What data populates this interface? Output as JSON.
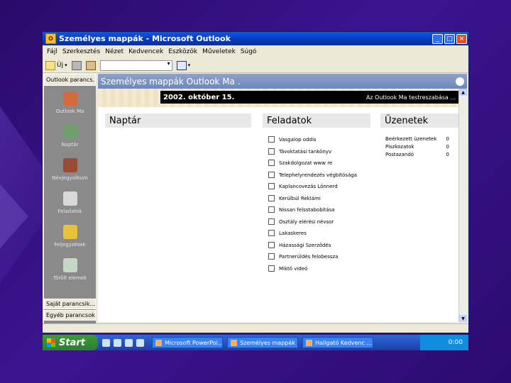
{
  "window": {
    "title": "Személyes mappák - Microsoft Outlook",
    "min": "_",
    "max": "□",
    "close": "×",
    "app_icon": "O"
  },
  "menu": [
    "Fájl",
    "Szerkesztés",
    "Nézet",
    "Kedvencek",
    "Eszközök",
    "Műveletek",
    "Súgó"
  ],
  "toolbar": {
    "new_label": "Új",
    "address_value": ""
  },
  "left_panel": {
    "header": "Outlook parancs...",
    "items": [
      {
        "label": "Outlook Ma",
        "icon": "outlook-today-icon",
        "color": "#d36b3c"
      },
      {
        "label": "Naptár",
        "icon": "calendar-icon",
        "color": "#6da06d"
      },
      {
        "label": "Névjegyalbum",
        "icon": "contacts-icon",
        "color": "#9b4a36"
      },
      {
        "label": "Feladatok",
        "icon": "tasks-icon",
        "color": "#d8d8d8"
      },
      {
        "label": "Feljegyzések",
        "icon": "notes-icon",
        "color": "#e8c23a"
      },
      {
        "label": "Törölt elemek",
        "icon": "deleted-items-icon",
        "color": "#c7d7c7"
      }
    ],
    "footer1": "Saját parancsik...",
    "footer2": "Egyéb parancsok..."
  },
  "main": {
    "header": "Személyes mappák   Outlook Ma .",
    "date": "2002. október 15.",
    "customize": "Az Outlook Ma testreszabása ...",
    "calendar_title": "Naptár",
    "tasks_title": "Feladatok",
    "messages_title": "Üzenetek",
    "tasks": [
      "Vasgalop oddis",
      "Távoktatási tankönyv",
      "Szakdolgozat www re",
      "Telephelyrendezés végbitósága",
      "Kaplancovezás Lönnerd",
      "Kerülbúl Reklámi",
      "Nissan felsstabobitása",
      "Osztály elérési névsor",
      "Lakaskeres",
      "Házassági Szerződés",
      "Partnerüldés felobessza",
      "Miktó videó"
    ],
    "messages": [
      {
        "label": "Beérkezett üzenetek",
        "count": "0"
      },
      {
        "label": "Piszkozatok",
        "count": "0"
      },
      {
        "label": "Postazandó",
        "count": "0"
      }
    ]
  },
  "taskbar": {
    "start": "Start",
    "tasks": [
      "Microsoft PowerPoi...",
      "Személyes mappák ...",
      "Hallgató Kedvenc ..."
    ],
    "clock": "0:00"
  }
}
